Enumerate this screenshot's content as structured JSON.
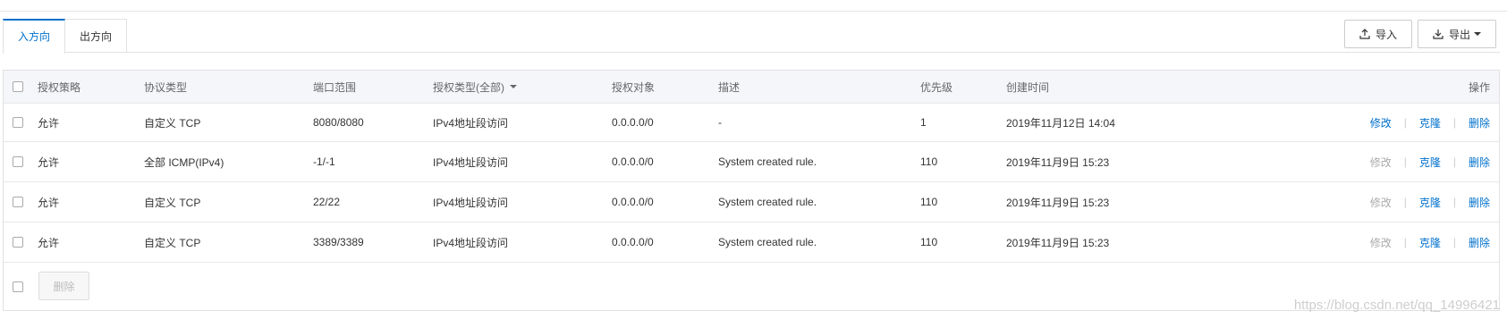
{
  "tabs": [
    {
      "label": "入方向",
      "active": true
    },
    {
      "label": "出方向",
      "active": false
    }
  ],
  "toolbar": {
    "import_label": "导入",
    "export_label": "导出"
  },
  "table": {
    "headers": {
      "policy": "授权策略",
      "protocol": "协议类型",
      "port_range": "端口范围",
      "auth_type": "授权类型(全部)",
      "auth_object": "授权对象",
      "description": "描述",
      "priority": "优先级",
      "created": "创建时间",
      "actions": "操作"
    },
    "rows": [
      {
        "policy": "允许",
        "protocol": "自定义 TCP",
        "port_range": "8080/8080",
        "auth_type": "IPv4地址段访问",
        "auth_object": "0.0.0.0/0",
        "description": "-",
        "priority": "1",
        "created": "2019年11月12日 14:04",
        "edit": "修改",
        "clone": "克隆",
        "delete": "删除",
        "edit_disabled": false
      },
      {
        "policy": "允许",
        "protocol": "全部 ICMP(IPv4)",
        "port_range": "-1/-1",
        "auth_type": "IPv4地址段访问",
        "auth_object": "0.0.0.0/0",
        "description": "System created rule.",
        "priority": "110",
        "created": "2019年11月9日 15:23",
        "edit": "修改",
        "clone": "克隆",
        "delete": "删除",
        "edit_disabled": true
      },
      {
        "policy": "允许",
        "protocol": "自定义 TCP",
        "port_range": "22/22",
        "auth_type": "IPv4地址段访问",
        "auth_object": "0.0.0.0/0",
        "description": "System created rule.",
        "priority": "110",
        "created": "2019年11月9日 15:23",
        "edit": "修改",
        "clone": "克隆",
        "delete": "删除",
        "edit_disabled": true
      },
      {
        "policy": "允许",
        "protocol": "自定义 TCP",
        "port_range": "3389/3389",
        "auth_type": "IPv4地址段访问",
        "auth_object": "0.0.0.0/0",
        "description": "System created rule.",
        "priority": "110",
        "created": "2019年11月9日 15:23",
        "edit": "修改",
        "clone": "克隆",
        "delete": "删除",
        "edit_disabled": true
      }
    ]
  },
  "footer": {
    "bulk_delete_label": "删除"
  },
  "watermark": "https://blog.csdn.net/qq_14996421",
  "colors": {
    "accent": "#0070cc",
    "disabled": "#aaaaaa",
    "header_bg": "#f5f6fa"
  }
}
